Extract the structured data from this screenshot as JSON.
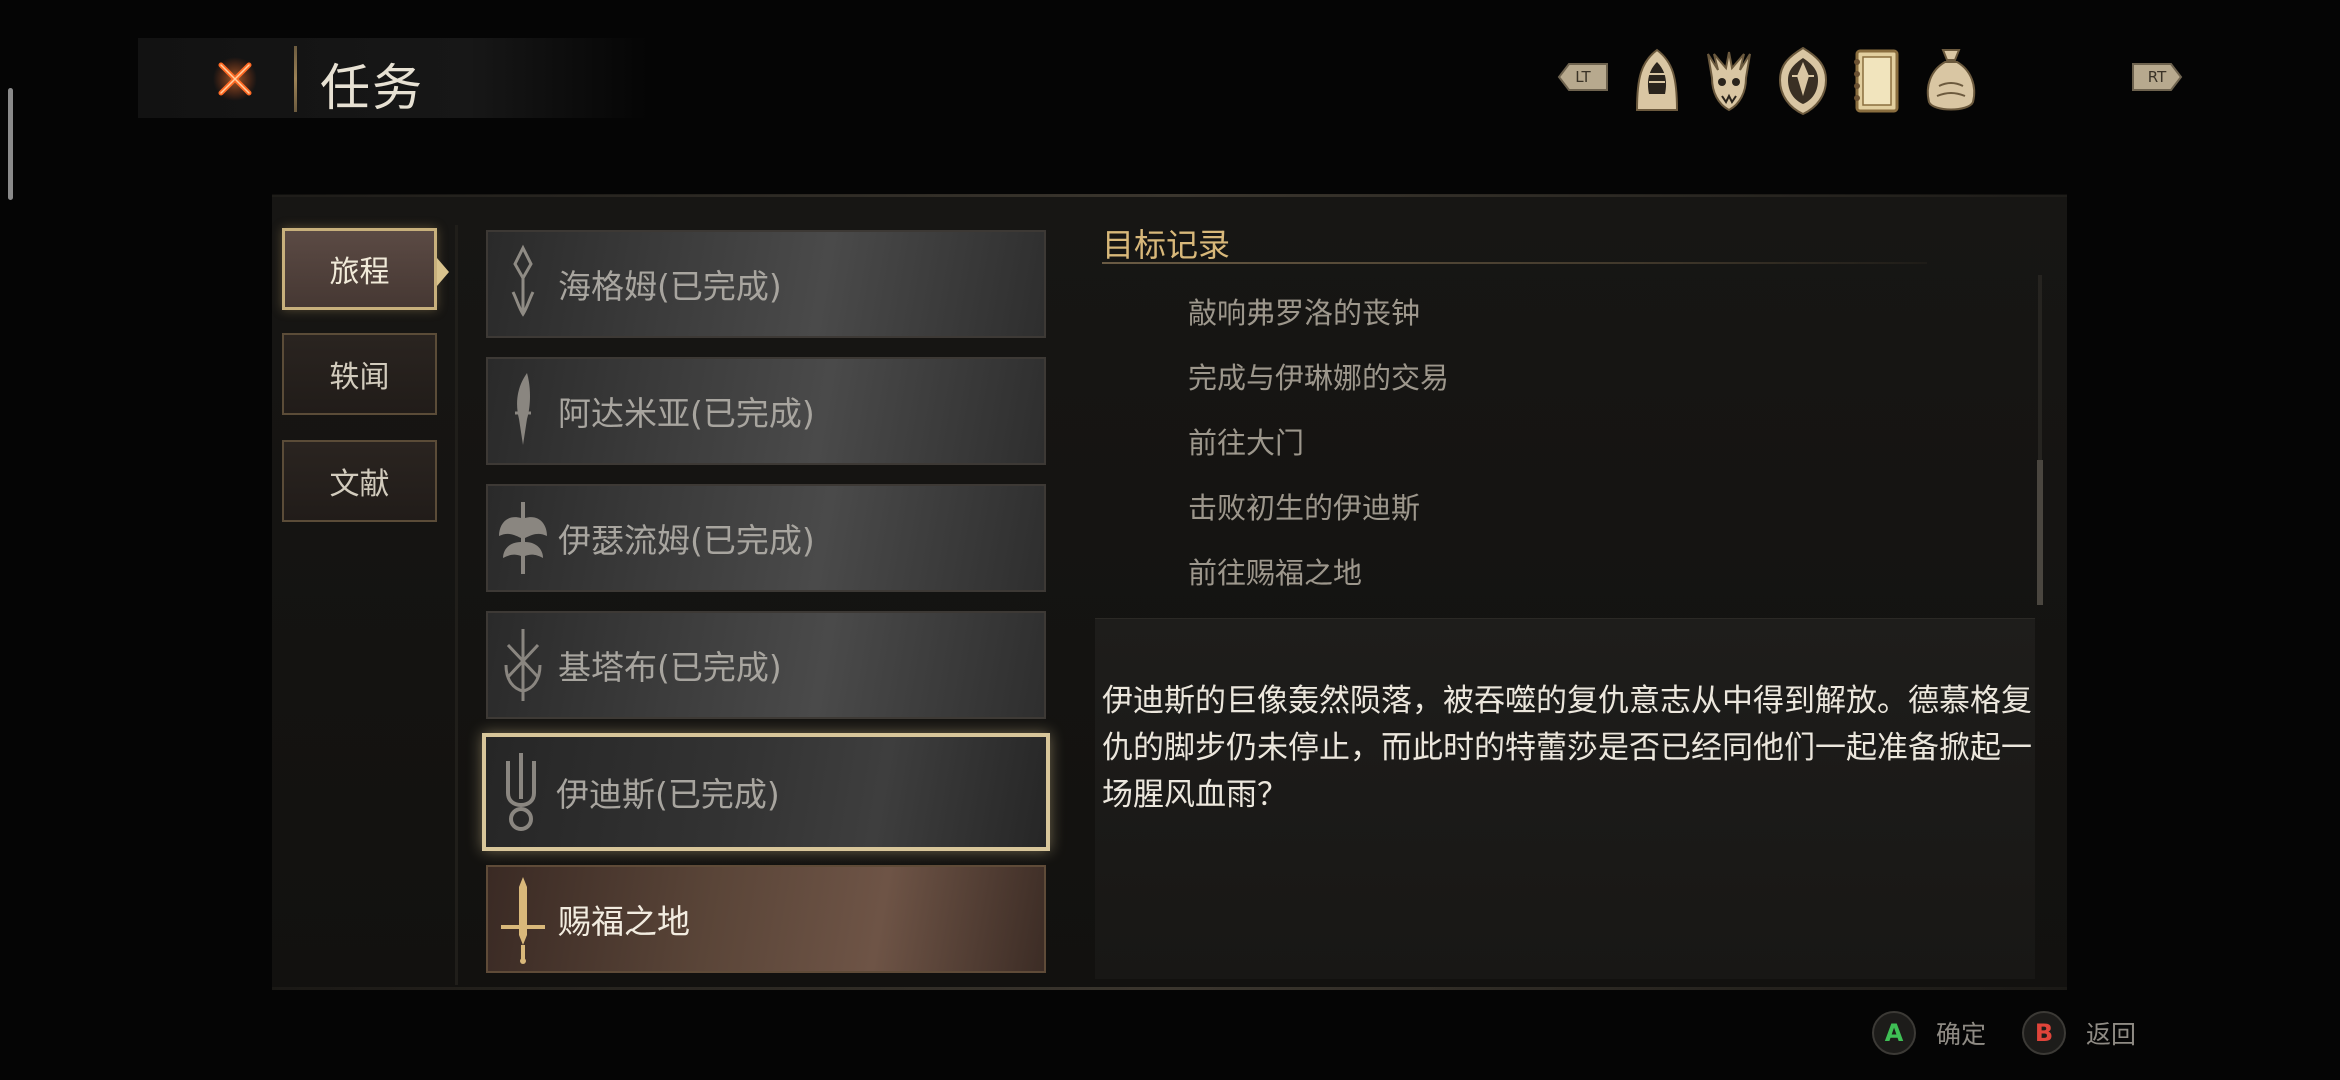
{
  "header": {
    "title": "任务",
    "close_icon": "close-x-icon"
  },
  "top_nav": {
    "left_shoulder": "LT",
    "right_shoulder": "RT",
    "icons": [
      "hooded-figure-icon",
      "beast-skull-icon",
      "emblem-shield-icon",
      "journal-book-icon",
      "coin-pouch-icon"
    ]
  },
  "side_tabs": [
    {
      "label": "旅程",
      "active": true
    },
    {
      "label": "轶闻",
      "active": false
    },
    {
      "label": "文献",
      "active": false
    }
  ],
  "quests": [
    {
      "name": "海格姆(已完成)",
      "icon": "hagram-sigil-icon"
    },
    {
      "name": "阿达米亚(已完成)",
      "icon": "adamia-sigil-icon"
    },
    {
      "name": "伊瑟流姆(已完成)",
      "icon": "isserlium-sigil-icon"
    },
    {
      "name": "基塔布(已完成)",
      "icon": "kitab-sigil-icon"
    },
    {
      "name": "伊迪斯(已完成)",
      "icon": "idris-sigil-icon",
      "selected": true
    },
    {
      "name": "赐福之地",
      "icon": "blessed-sword-icon",
      "current": true
    }
  ],
  "objectives": {
    "header": "目标记录",
    "items": [
      "敲响弗罗洛的丧钟",
      "完成与伊琳娜的交易",
      "前往大门",
      "击败初生的伊迪斯",
      "前往赐福之地"
    ]
  },
  "description": "伊迪斯的巨像轰然陨落，被吞噬的复仇意志从中得到解放。德慕格复仇的脚步仍未停止，而此时的特蕾莎是否已经同他们一起准备掀起一场腥风血雨？",
  "footer": {
    "confirm": {
      "key": "A",
      "label": "确定",
      "color": "#3fbf55"
    },
    "back": {
      "key": "B",
      "label": "返回",
      "color": "#e0443a"
    }
  },
  "colors": {
    "accent_gold": "#c8b07c",
    "objective_header": "#d8b87a"
  }
}
